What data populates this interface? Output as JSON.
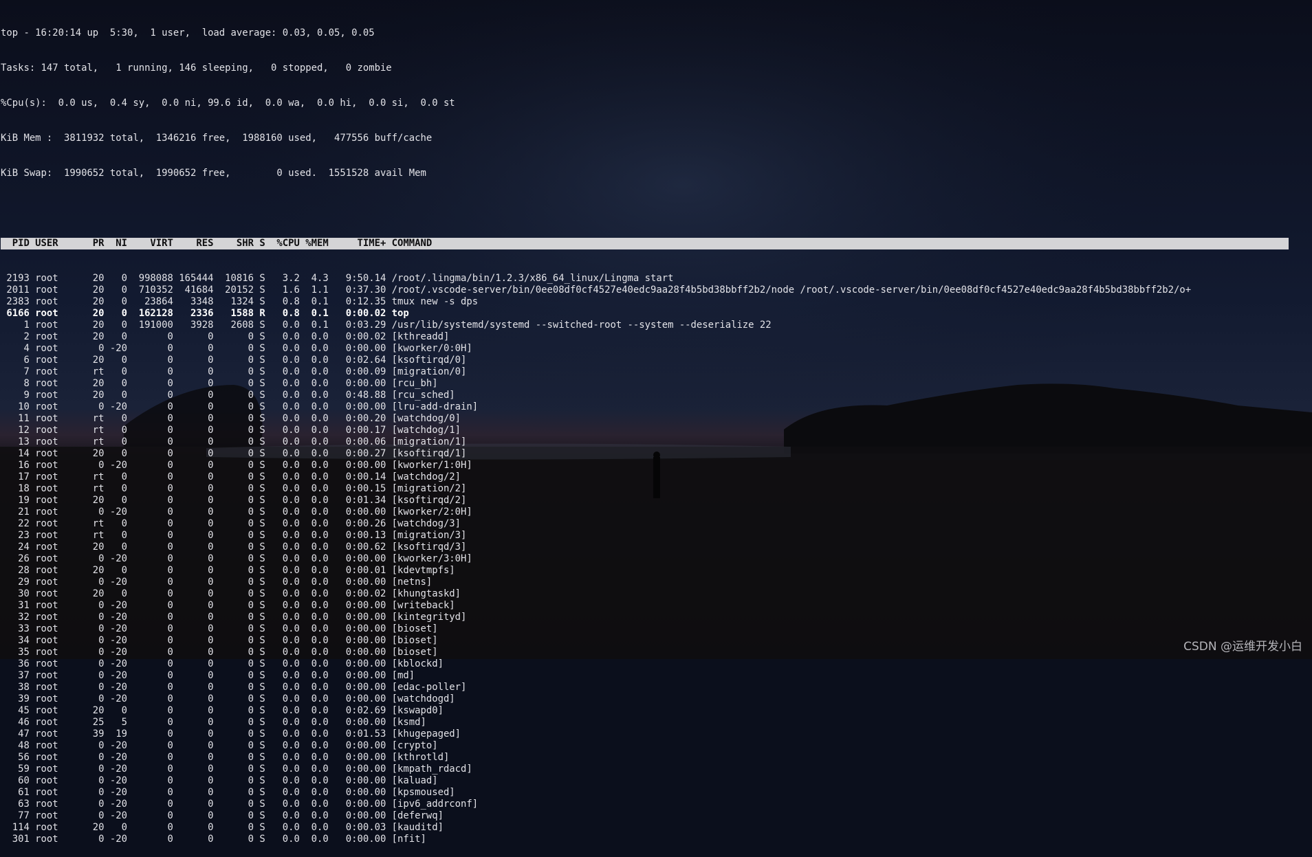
{
  "summary": {
    "line1": "top - 16:20:14 up  5:30,  1 user,  load average: 0.03, 0.05, 0.05",
    "line2": "Tasks: 147 total,   1 running, 146 sleeping,   0 stopped,   0 zombie",
    "line3": "%Cpu(s):  0.0 us,  0.4 sy,  0.0 ni, 99.6 id,  0.0 wa,  0.0 hi,  0.0 si,  0.0 st",
    "line4": "KiB Mem :  3811932 total,  1346216 free,  1988160 used,   477556 buff/cache",
    "line5": "KiB Swap:  1990652 total,  1990652 free,        0 used.  1551528 avail Mem"
  },
  "table_header": "  PID USER      PR  NI    VIRT    RES    SHR S  %CPU %MEM     TIME+ COMMAND                                                                                                        ",
  "columns": [
    "PID",
    "USER",
    "PR",
    "NI",
    "VIRT",
    "RES",
    "SHR",
    "S",
    "%CPU",
    "%MEM",
    "TIME+",
    "COMMAND"
  ],
  "processes": [
    {
      "pid": "2193",
      "user": "root",
      "pr": "20",
      "ni": "0",
      "virt": "998088",
      "res": "165444",
      "shr": "10816",
      "s": "S",
      "cpu": "3.2",
      "mem": "4.3",
      "time": "9:50.14",
      "cmd": "/root/.lingma/bin/1.2.3/x86_64_linux/Lingma start"
    },
    {
      "pid": "2011",
      "user": "root",
      "pr": "20",
      "ni": "0",
      "virt": "710352",
      "res": "41684",
      "shr": "20152",
      "s": "S",
      "cpu": "1.6",
      "mem": "1.1",
      "time": "0:37.30",
      "cmd": "/root/.vscode-server/bin/0ee08df0cf4527e40edc9aa28f4b5bd38bbff2b2/node /root/.vscode-server/bin/0ee08df0cf4527e40edc9aa28f4b5bd38bbff2b2/o+"
    },
    {
      "pid": "2383",
      "user": "root",
      "pr": "20",
      "ni": "0",
      "virt": "23864",
      "res": "3348",
      "shr": "1324",
      "s": "S",
      "cpu": "0.8",
      "mem": "0.1",
      "time": "0:12.35",
      "cmd": "tmux new -s dps"
    },
    {
      "pid": "6166",
      "user": "root",
      "pr": "20",
      "ni": "0",
      "virt": "162128",
      "res": "2336",
      "shr": "1588",
      "s": "R",
      "cpu": "0.8",
      "mem": "0.1",
      "time": "0:00.02",
      "cmd": "top",
      "bold": true
    },
    {
      "pid": "1",
      "user": "root",
      "pr": "20",
      "ni": "0",
      "virt": "191000",
      "res": "3928",
      "shr": "2608",
      "s": "S",
      "cpu": "0.0",
      "mem": "0.1",
      "time": "0:03.29",
      "cmd": "/usr/lib/systemd/systemd --switched-root --system --deserialize 22"
    },
    {
      "pid": "2",
      "user": "root",
      "pr": "20",
      "ni": "0",
      "virt": "0",
      "res": "0",
      "shr": "0",
      "s": "S",
      "cpu": "0.0",
      "mem": "0.0",
      "time": "0:00.02",
      "cmd": "[kthreadd]"
    },
    {
      "pid": "4",
      "user": "root",
      "pr": "0",
      "ni": "-20",
      "virt": "0",
      "res": "0",
      "shr": "0",
      "s": "S",
      "cpu": "0.0",
      "mem": "0.0",
      "time": "0:00.00",
      "cmd": "[kworker/0:0H]"
    },
    {
      "pid": "6",
      "user": "root",
      "pr": "20",
      "ni": "0",
      "virt": "0",
      "res": "0",
      "shr": "0",
      "s": "S",
      "cpu": "0.0",
      "mem": "0.0",
      "time": "0:02.64",
      "cmd": "[ksoftirqd/0]"
    },
    {
      "pid": "7",
      "user": "root",
      "pr": "rt",
      "ni": "0",
      "virt": "0",
      "res": "0",
      "shr": "0",
      "s": "S",
      "cpu": "0.0",
      "mem": "0.0",
      "time": "0:00.09",
      "cmd": "[migration/0]"
    },
    {
      "pid": "8",
      "user": "root",
      "pr": "20",
      "ni": "0",
      "virt": "0",
      "res": "0",
      "shr": "0",
      "s": "S",
      "cpu": "0.0",
      "mem": "0.0",
      "time": "0:00.00",
      "cmd": "[rcu_bh]"
    },
    {
      "pid": "9",
      "user": "root",
      "pr": "20",
      "ni": "0",
      "virt": "0",
      "res": "0",
      "shr": "0",
      "s": "S",
      "cpu": "0.0",
      "mem": "0.0",
      "time": "0:48.88",
      "cmd": "[rcu_sched]"
    },
    {
      "pid": "10",
      "user": "root",
      "pr": "0",
      "ni": "-20",
      "virt": "0",
      "res": "0",
      "shr": "0",
      "s": "S",
      "cpu": "0.0",
      "mem": "0.0",
      "time": "0:00.00",
      "cmd": "[lru-add-drain]"
    },
    {
      "pid": "11",
      "user": "root",
      "pr": "rt",
      "ni": "0",
      "virt": "0",
      "res": "0",
      "shr": "0",
      "s": "S",
      "cpu": "0.0",
      "mem": "0.0",
      "time": "0:00.20",
      "cmd": "[watchdog/0]"
    },
    {
      "pid": "12",
      "user": "root",
      "pr": "rt",
      "ni": "0",
      "virt": "0",
      "res": "0",
      "shr": "0",
      "s": "S",
      "cpu": "0.0",
      "mem": "0.0",
      "time": "0:00.17",
      "cmd": "[watchdog/1]"
    },
    {
      "pid": "13",
      "user": "root",
      "pr": "rt",
      "ni": "0",
      "virt": "0",
      "res": "0",
      "shr": "0",
      "s": "S",
      "cpu": "0.0",
      "mem": "0.0",
      "time": "0:00.06",
      "cmd": "[migration/1]"
    },
    {
      "pid": "14",
      "user": "root",
      "pr": "20",
      "ni": "0",
      "virt": "0",
      "res": "0",
      "shr": "0",
      "s": "S",
      "cpu": "0.0",
      "mem": "0.0",
      "time": "0:00.27",
      "cmd": "[ksoftirqd/1]"
    },
    {
      "pid": "16",
      "user": "root",
      "pr": "0",
      "ni": "-20",
      "virt": "0",
      "res": "0",
      "shr": "0",
      "s": "S",
      "cpu": "0.0",
      "mem": "0.0",
      "time": "0:00.00",
      "cmd": "[kworker/1:0H]"
    },
    {
      "pid": "17",
      "user": "root",
      "pr": "rt",
      "ni": "0",
      "virt": "0",
      "res": "0",
      "shr": "0",
      "s": "S",
      "cpu": "0.0",
      "mem": "0.0",
      "time": "0:00.14",
      "cmd": "[watchdog/2]"
    },
    {
      "pid": "18",
      "user": "root",
      "pr": "rt",
      "ni": "0",
      "virt": "0",
      "res": "0",
      "shr": "0",
      "s": "S",
      "cpu": "0.0",
      "mem": "0.0",
      "time": "0:00.15",
      "cmd": "[migration/2]"
    },
    {
      "pid": "19",
      "user": "root",
      "pr": "20",
      "ni": "0",
      "virt": "0",
      "res": "0",
      "shr": "0",
      "s": "S",
      "cpu": "0.0",
      "mem": "0.0",
      "time": "0:01.34",
      "cmd": "[ksoftirqd/2]"
    },
    {
      "pid": "21",
      "user": "root",
      "pr": "0",
      "ni": "-20",
      "virt": "0",
      "res": "0",
      "shr": "0",
      "s": "S",
      "cpu": "0.0",
      "mem": "0.0",
      "time": "0:00.00",
      "cmd": "[kworker/2:0H]"
    },
    {
      "pid": "22",
      "user": "root",
      "pr": "rt",
      "ni": "0",
      "virt": "0",
      "res": "0",
      "shr": "0",
      "s": "S",
      "cpu": "0.0",
      "mem": "0.0",
      "time": "0:00.26",
      "cmd": "[watchdog/3]"
    },
    {
      "pid": "23",
      "user": "root",
      "pr": "rt",
      "ni": "0",
      "virt": "0",
      "res": "0",
      "shr": "0",
      "s": "S",
      "cpu": "0.0",
      "mem": "0.0",
      "time": "0:00.13",
      "cmd": "[migration/3]"
    },
    {
      "pid": "24",
      "user": "root",
      "pr": "20",
      "ni": "0",
      "virt": "0",
      "res": "0",
      "shr": "0",
      "s": "S",
      "cpu": "0.0",
      "mem": "0.0",
      "time": "0:00.62",
      "cmd": "[ksoftirqd/3]"
    },
    {
      "pid": "26",
      "user": "root",
      "pr": "0",
      "ni": "-20",
      "virt": "0",
      "res": "0",
      "shr": "0",
      "s": "S",
      "cpu": "0.0",
      "mem": "0.0",
      "time": "0:00.00",
      "cmd": "[kworker/3:0H]"
    },
    {
      "pid": "28",
      "user": "root",
      "pr": "20",
      "ni": "0",
      "virt": "0",
      "res": "0",
      "shr": "0",
      "s": "S",
      "cpu": "0.0",
      "mem": "0.0",
      "time": "0:00.01",
      "cmd": "[kdevtmpfs]"
    },
    {
      "pid": "29",
      "user": "root",
      "pr": "0",
      "ni": "-20",
      "virt": "0",
      "res": "0",
      "shr": "0",
      "s": "S",
      "cpu": "0.0",
      "mem": "0.0",
      "time": "0:00.00",
      "cmd": "[netns]"
    },
    {
      "pid": "30",
      "user": "root",
      "pr": "20",
      "ni": "0",
      "virt": "0",
      "res": "0",
      "shr": "0",
      "s": "S",
      "cpu": "0.0",
      "mem": "0.0",
      "time": "0:00.02",
      "cmd": "[khungtaskd]"
    },
    {
      "pid": "31",
      "user": "root",
      "pr": "0",
      "ni": "-20",
      "virt": "0",
      "res": "0",
      "shr": "0",
      "s": "S",
      "cpu": "0.0",
      "mem": "0.0",
      "time": "0:00.00",
      "cmd": "[writeback]"
    },
    {
      "pid": "32",
      "user": "root",
      "pr": "0",
      "ni": "-20",
      "virt": "0",
      "res": "0",
      "shr": "0",
      "s": "S",
      "cpu": "0.0",
      "mem": "0.0",
      "time": "0:00.00",
      "cmd": "[kintegrityd]"
    },
    {
      "pid": "33",
      "user": "root",
      "pr": "0",
      "ni": "-20",
      "virt": "0",
      "res": "0",
      "shr": "0",
      "s": "S",
      "cpu": "0.0",
      "mem": "0.0",
      "time": "0:00.00",
      "cmd": "[bioset]"
    },
    {
      "pid": "34",
      "user": "root",
      "pr": "0",
      "ni": "-20",
      "virt": "0",
      "res": "0",
      "shr": "0",
      "s": "S",
      "cpu": "0.0",
      "mem": "0.0",
      "time": "0:00.00",
      "cmd": "[bioset]"
    },
    {
      "pid": "35",
      "user": "root",
      "pr": "0",
      "ni": "-20",
      "virt": "0",
      "res": "0",
      "shr": "0",
      "s": "S",
      "cpu": "0.0",
      "mem": "0.0",
      "time": "0:00.00",
      "cmd": "[bioset]"
    },
    {
      "pid": "36",
      "user": "root",
      "pr": "0",
      "ni": "-20",
      "virt": "0",
      "res": "0",
      "shr": "0",
      "s": "S",
      "cpu": "0.0",
      "mem": "0.0",
      "time": "0:00.00",
      "cmd": "[kblockd]"
    },
    {
      "pid": "37",
      "user": "root",
      "pr": "0",
      "ni": "-20",
      "virt": "0",
      "res": "0",
      "shr": "0",
      "s": "S",
      "cpu": "0.0",
      "mem": "0.0",
      "time": "0:00.00",
      "cmd": "[md]"
    },
    {
      "pid": "38",
      "user": "root",
      "pr": "0",
      "ni": "-20",
      "virt": "0",
      "res": "0",
      "shr": "0",
      "s": "S",
      "cpu": "0.0",
      "mem": "0.0",
      "time": "0:00.00",
      "cmd": "[edac-poller]"
    },
    {
      "pid": "39",
      "user": "root",
      "pr": "0",
      "ni": "-20",
      "virt": "0",
      "res": "0",
      "shr": "0",
      "s": "S",
      "cpu": "0.0",
      "mem": "0.0",
      "time": "0:00.00",
      "cmd": "[watchdogd]"
    },
    {
      "pid": "45",
      "user": "root",
      "pr": "20",
      "ni": "0",
      "virt": "0",
      "res": "0",
      "shr": "0",
      "s": "S",
      "cpu": "0.0",
      "mem": "0.0",
      "time": "0:02.69",
      "cmd": "[kswapd0]"
    },
    {
      "pid": "46",
      "user": "root",
      "pr": "25",
      "ni": "5",
      "virt": "0",
      "res": "0",
      "shr": "0",
      "s": "S",
      "cpu": "0.0",
      "mem": "0.0",
      "time": "0:00.00",
      "cmd": "[ksmd]"
    },
    {
      "pid": "47",
      "user": "root",
      "pr": "39",
      "ni": "19",
      "virt": "0",
      "res": "0",
      "shr": "0",
      "s": "S",
      "cpu": "0.0",
      "mem": "0.0",
      "time": "0:01.53",
      "cmd": "[khugepaged]"
    },
    {
      "pid": "48",
      "user": "root",
      "pr": "0",
      "ni": "-20",
      "virt": "0",
      "res": "0",
      "shr": "0",
      "s": "S",
      "cpu": "0.0",
      "mem": "0.0",
      "time": "0:00.00",
      "cmd": "[crypto]"
    },
    {
      "pid": "56",
      "user": "root",
      "pr": "0",
      "ni": "-20",
      "virt": "0",
      "res": "0",
      "shr": "0",
      "s": "S",
      "cpu": "0.0",
      "mem": "0.0",
      "time": "0:00.00",
      "cmd": "[kthrotld]"
    },
    {
      "pid": "59",
      "user": "root",
      "pr": "0",
      "ni": "-20",
      "virt": "0",
      "res": "0",
      "shr": "0",
      "s": "S",
      "cpu": "0.0",
      "mem": "0.0",
      "time": "0:00.00",
      "cmd": "[kmpath_rdacd]"
    },
    {
      "pid": "60",
      "user": "root",
      "pr": "0",
      "ni": "-20",
      "virt": "0",
      "res": "0",
      "shr": "0",
      "s": "S",
      "cpu": "0.0",
      "mem": "0.0",
      "time": "0:00.00",
      "cmd": "[kaluad]"
    },
    {
      "pid": "61",
      "user": "root",
      "pr": "0",
      "ni": "-20",
      "virt": "0",
      "res": "0",
      "shr": "0",
      "s": "S",
      "cpu": "0.0",
      "mem": "0.0",
      "time": "0:00.00",
      "cmd": "[kpsmoused]"
    },
    {
      "pid": "63",
      "user": "root",
      "pr": "0",
      "ni": "-20",
      "virt": "0",
      "res": "0",
      "shr": "0",
      "s": "S",
      "cpu": "0.0",
      "mem": "0.0",
      "time": "0:00.00",
      "cmd": "[ipv6_addrconf]"
    },
    {
      "pid": "77",
      "user": "root",
      "pr": "0",
      "ni": "-20",
      "virt": "0",
      "res": "0",
      "shr": "0",
      "s": "S",
      "cpu": "0.0",
      "mem": "0.0",
      "time": "0:00.00",
      "cmd": "[deferwq]"
    },
    {
      "pid": "114",
      "user": "root",
      "pr": "20",
      "ni": "0",
      "virt": "0",
      "res": "0",
      "shr": "0",
      "s": "S",
      "cpu": "0.0",
      "mem": "0.0",
      "time": "0:00.03",
      "cmd": "[kauditd]"
    },
    {
      "pid": "301",
      "user": "root",
      "pr": "0",
      "ni": "-20",
      "virt": "0",
      "res": "0",
      "shr": "0",
      "s": "S",
      "cpu": "0.0",
      "mem": "0.0",
      "time": "0:00.00",
      "cmd": "[nfit]"
    }
  ],
  "watermark": "CSDN @运维开发小白",
  "colors": {
    "terminal_text": "#e3e3e8",
    "header_bar": "#d4d4d6",
    "header_text": "#0e0e10",
    "sky": "#0b0f1c",
    "horizon_glow": "#c4461a"
  }
}
